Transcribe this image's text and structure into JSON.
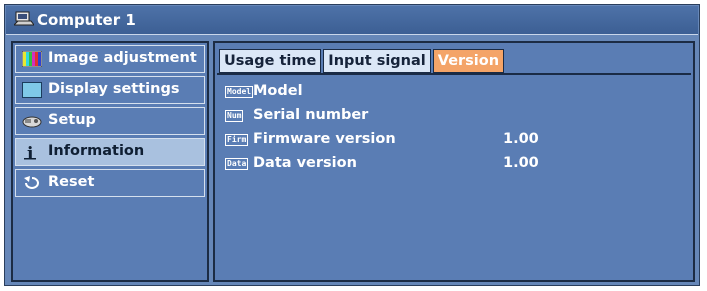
{
  "window": {
    "title": "Computer 1",
    "title_icon": "computer-icon"
  },
  "sidebar": {
    "items": [
      {
        "label": "Image adjustment",
        "icon": "color-bars-icon",
        "selected": false
      },
      {
        "label": "Display settings",
        "icon": "display-icon",
        "selected": false
      },
      {
        "label": "Setup",
        "icon": "setup-icon",
        "selected": false
      },
      {
        "label": "Information",
        "icon": "info-icon",
        "selected": true
      },
      {
        "label": "Reset",
        "icon": "reset-icon",
        "selected": false
      }
    ]
  },
  "tabs": [
    {
      "label": "Usage time",
      "active": false
    },
    {
      "label": "Input signal",
      "active": false
    },
    {
      "label": "Version",
      "active": true
    }
  ],
  "rows": [
    {
      "badge": "Model",
      "label": "Model",
      "value": ""
    },
    {
      "badge": "Num",
      "label": "Serial number",
      "value": ""
    },
    {
      "badge": "Firm",
      "label": "Firmware version",
      "value": "1.00"
    },
    {
      "badge": "Data",
      "label": "Data version",
      "value": "1.00"
    }
  ],
  "colors": {
    "panel_bg": "#5a7db4",
    "active_tab": "#f4a468",
    "selected_item": "#a9c1df"
  }
}
